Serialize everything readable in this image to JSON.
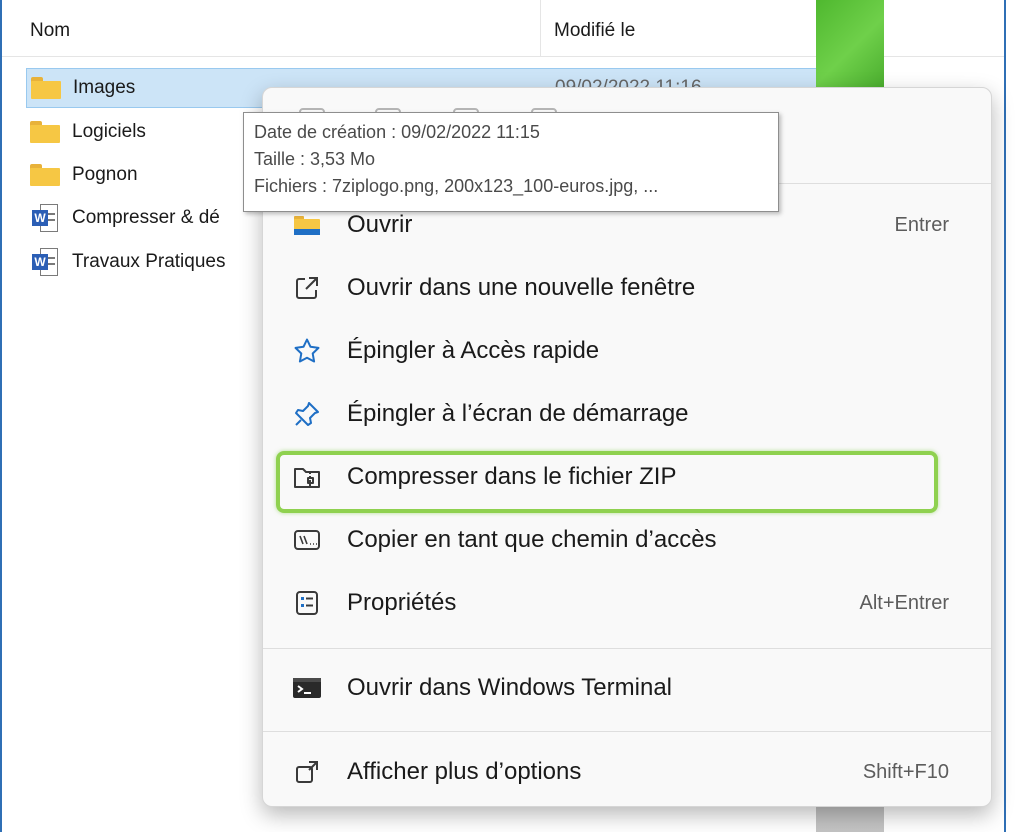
{
  "header": {
    "col_name": "Nom",
    "col_modified": "Modifié le"
  },
  "files": [
    {
      "name": "Images",
      "type": "folder-icon",
      "modified": "09/02/2022 11:16",
      "selected": true
    },
    {
      "name": "Logiciels",
      "type": "folder-icon",
      "modified": ""
    },
    {
      "name": "Pognon",
      "type": "folder-icon",
      "modified": ""
    },
    {
      "name": "Compresser & dé",
      "type": "word-icon",
      "modified": ""
    },
    {
      "name": "Travaux Pratiques",
      "type": "word-icon",
      "modified": ""
    }
  ],
  "tooltip": {
    "created": "Date de création : 09/02/2022 11:15",
    "size": "Taille : 3,53 Mo",
    "files": "Fichiers : 7ziplogo.png, 200x123_100-euros.jpg, ..."
  },
  "menu": {
    "items": [
      {
        "label": "Ouvrir",
        "shortcut": "Entrer",
        "icon": "folder-icon"
      },
      {
        "label": "Ouvrir dans une nouvelle fenêtre",
        "shortcut": "",
        "icon": "open-new-window-icon"
      },
      {
        "label": "Épingler à Accès rapide",
        "shortcut": "",
        "icon": "star-icon"
      },
      {
        "label": "Épingler à l’écran de démarrage",
        "shortcut": "",
        "icon": "pin-icon"
      },
      {
        "label": "Compresser dans le fichier ZIP",
        "shortcut": "",
        "icon": "zip-folder-icon"
      },
      {
        "label": "Copier en tant que chemin d’accès",
        "shortcut": "",
        "icon": "copy-path-icon"
      },
      {
        "label": "Propriétés",
        "shortcut": "Alt+Entrer",
        "icon": "properties-icon"
      },
      {
        "label": "Ouvrir dans Windows Terminal",
        "shortcut": "",
        "icon": "terminal-icon"
      },
      {
        "label": "Afficher plus d’options",
        "shortcut": "Shift+F10",
        "icon": "more-options-icon"
      }
    ]
  },
  "colors": {
    "accent": "#0067c0",
    "highlight": "#8fd14f",
    "selection": "#cce4f7"
  }
}
